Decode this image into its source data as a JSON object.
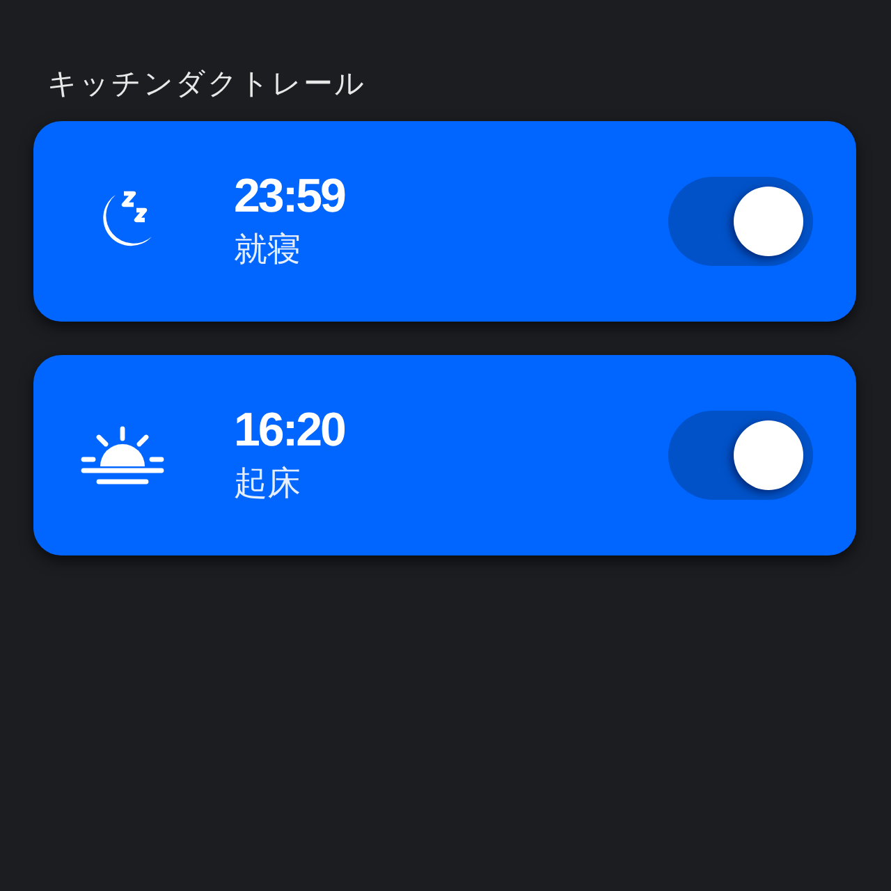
{
  "section_title": "キッチンダクトレール",
  "alarms": [
    {
      "kind": "sleep",
      "time": "23:59",
      "label": "就寝",
      "on": true
    },
    {
      "kind": "wake",
      "time": "16:20",
      "label": "起床",
      "on": true
    }
  ]
}
